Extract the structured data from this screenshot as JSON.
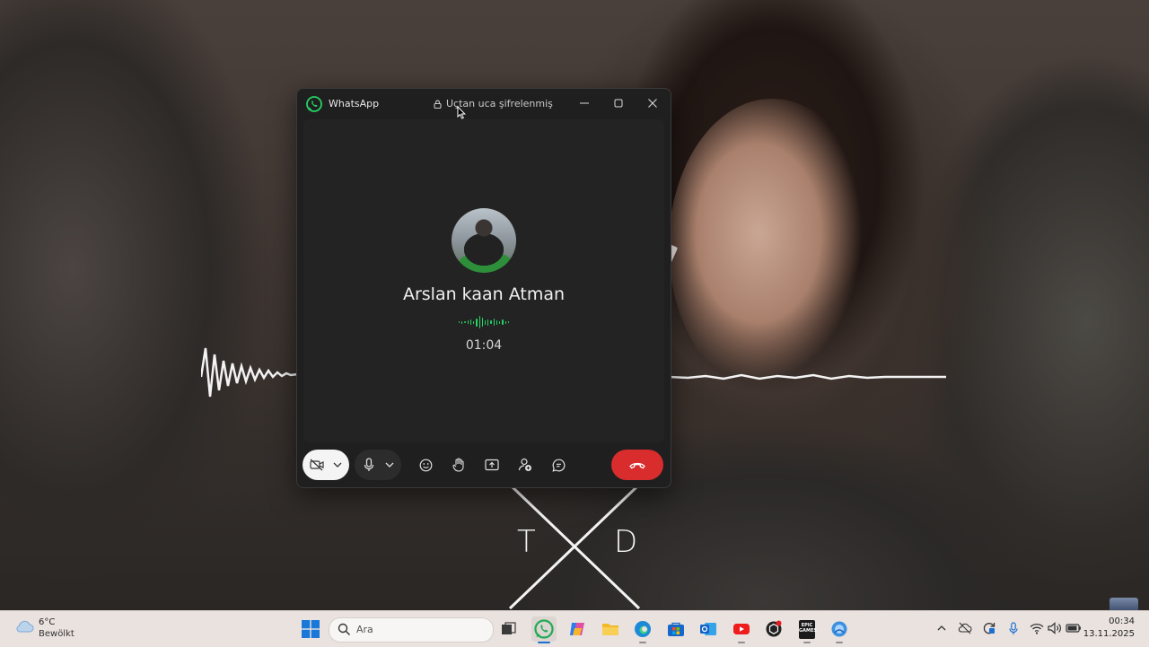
{
  "window": {
    "app_name": "WhatsApp",
    "encryption_label": "Uçtan uca şifrelenmiş",
    "minimize_icon": "minimize-icon",
    "maximize_icon": "maximize-icon",
    "close_icon": "close-icon"
  },
  "call": {
    "caller_name": "Arslan kaan Atman",
    "duration": "01:04",
    "status_color": "#25d366",
    "controls": [
      {
        "name": "camera-off-button",
        "icon": "video-off-icon"
      },
      {
        "name": "camera-options-button",
        "icon": "chevron-down-icon"
      },
      {
        "name": "mute-button",
        "icon": "microphone-icon"
      },
      {
        "name": "mic-options-button",
        "icon": "chevron-down-icon"
      },
      {
        "name": "reactions-button",
        "icon": "emoji-icon"
      },
      {
        "name": "raise-hand-button",
        "icon": "hand-icon"
      },
      {
        "name": "share-screen-button",
        "icon": "share-screen-icon"
      },
      {
        "name": "add-participant-button",
        "icon": "add-person-icon"
      },
      {
        "name": "chat-button",
        "icon": "chat-icon"
      },
      {
        "name": "end-call-button",
        "icon": "hang-up-icon"
      }
    ],
    "end_call_color": "#d92d2d"
  },
  "wallpaper": {
    "letters": [
      "T",
      "D"
    ]
  },
  "taskbar": {
    "weather": {
      "temp": "6°C",
      "desc": "Bewölkt",
      "icon": "cloud-icon"
    },
    "search_placeholder": "Ara",
    "apps": [
      {
        "name": "start",
        "icon": "windows-icon"
      },
      {
        "name": "task-view",
        "icon": "task-view-icon"
      },
      {
        "name": "whatsapp",
        "icon": "whatsapp-icon",
        "active": true
      },
      {
        "name": "copilot",
        "icon": "copilot-icon"
      },
      {
        "name": "file-explorer",
        "icon": "folder-icon"
      },
      {
        "name": "edge",
        "icon": "edge-icon"
      },
      {
        "name": "microsoft-store",
        "icon": "store-icon"
      },
      {
        "name": "outlook",
        "icon": "outlook-icon"
      },
      {
        "name": "youtube",
        "icon": "youtube-icon"
      },
      {
        "name": "chatgpt",
        "icon": "chatgpt-icon"
      },
      {
        "name": "epic-games",
        "icon": "epic-games-icon",
        "label": "EPIC GAMES"
      },
      {
        "name": "chrome-app",
        "icon": "app-icon"
      }
    ],
    "tray": [
      "chevron-up-icon",
      "cloud-off-icon",
      "sync-icon",
      "microphone-icon",
      "wifi-icon",
      "volume-icon",
      "battery-icon"
    ],
    "clock": {
      "time": "00:34",
      "date": "13.11.2025"
    }
  }
}
